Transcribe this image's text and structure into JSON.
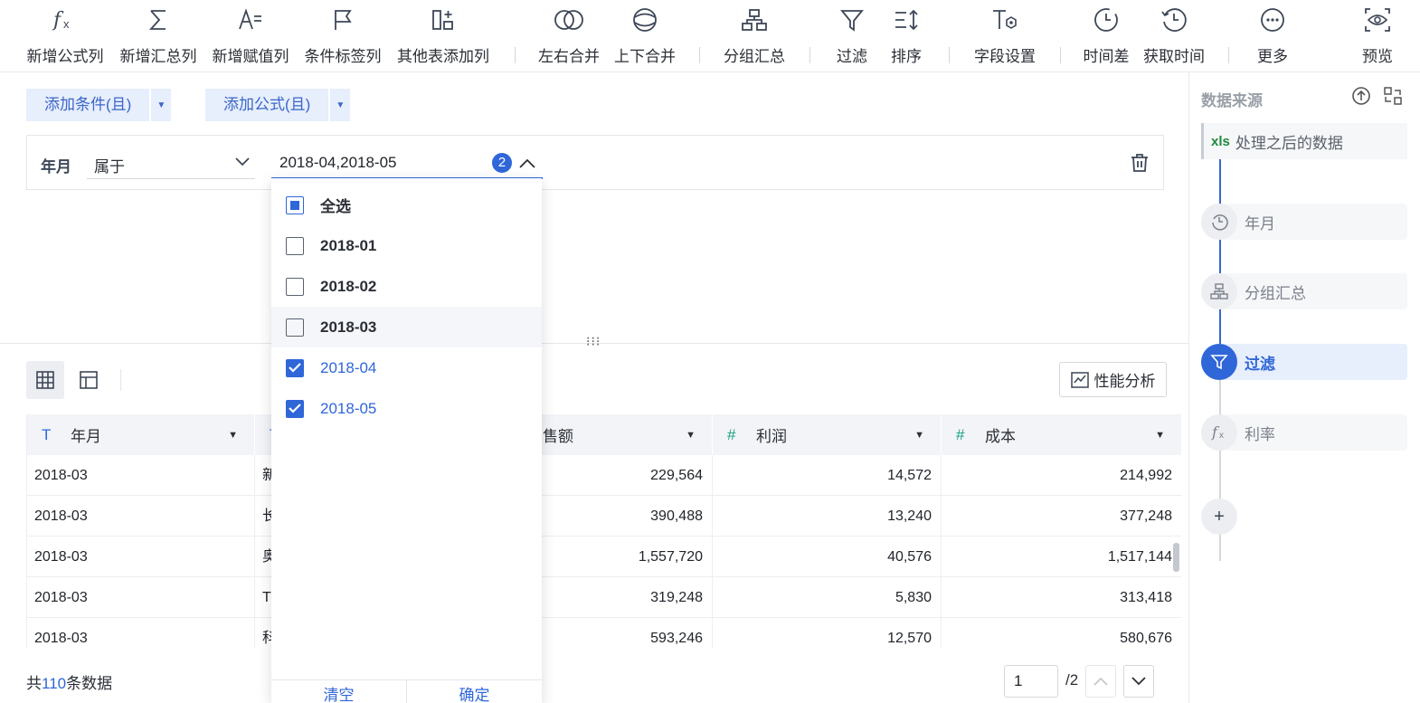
{
  "toolbar": {
    "items": [
      {
        "label": "新增公式列",
        "icon": "formula-icon"
      },
      {
        "label": "新增汇总列",
        "icon": "sum-icon"
      },
      {
        "label": "新增赋值列",
        "icon": "assign-icon"
      },
      {
        "label": "条件标签列",
        "icon": "flag-icon"
      },
      {
        "label": "其他表添加列",
        "icon": "add-column-icon"
      },
      {
        "label": "左右合并",
        "icon": "horizontal-merge-icon"
      },
      {
        "label": "上下合并",
        "icon": "vertical-merge-icon"
      },
      {
        "label": "分组汇总",
        "icon": "group-icon"
      },
      {
        "label": "过滤",
        "icon": "filter-icon"
      },
      {
        "label": "排序",
        "icon": "sort-icon"
      },
      {
        "label": "字段设置",
        "icon": "field-settings-icon"
      },
      {
        "label": "时间差",
        "icon": "time-diff-icon"
      },
      {
        "label": "获取时间",
        "icon": "get-time-icon"
      },
      {
        "label": "更多",
        "icon": "more-icon"
      },
      {
        "label": "预览",
        "icon": "preview-icon"
      }
    ]
  },
  "filter": {
    "add_condition": "添加条件(且)",
    "add_formula": "添加公式(且)",
    "field": "年月",
    "operator": "属于",
    "value": "2018-04,2018-05",
    "selected_count": "2"
  },
  "dropdown": {
    "options": [
      {
        "label": "全选",
        "state": "partial"
      },
      {
        "label": "2018-01",
        "state": "unchecked"
      },
      {
        "label": "2018-02",
        "state": "unchecked"
      },
      {
        "label": "2018-03",
        "state": "unchecked"
      },
      {
        "label": "2018-04",
        "state": "checked"
      },
      {
        "label": "2018-05",
        "state": "checked"
      }
    ],
    "clear": "清空",
    "confirm": "确定"
  },
  "preview": {
    "perf_label": "性能分析",
    "columns": [
      {
        "type_icon": "T",
        "name": "年月"
      },
      {
        "type_icon": "T",
        "name": ""
      },
      {
        "type_icon": "#",
        "name": "销售额"
      },
      {
        "type_icon": "#",
        "name": "利润"
      },
      {
        "type_icon": "#",
        "name": "成本"
      }
    ],
    "rows": [
      {
        "month": "2018-03",
        "name": "新",
        "sales": "229,564",
        "profit": "14,572",
        "cost": "214,992"
      },
      {
        "month": "2018-03",
        "name": "长",
        "sales": "390,488",
        "profit": "13,240",
        "cost": "377,248"
      },
      {
        "month": "2018-03",
        "name": "奥",
        "sales": "1,557,720",
        "profit": "40,576",
        "cost": "1,517,144"
      },
      {
        "month": "2018-03",
        "name": "T",
        "sales": "319,248",
        "profit": "5,830",
        "cost": "313,418"
      },
      {
        "month": "2018-03",
        "name": "科",
        "sales": "593,246",
        "profit": "12,570",
        "cost": "580,676"
      }
    ],
    "count_prefix": "共",
    "count": "110",
    "count_suffix": "条数据",
    "page": "1",
    "page_total": "/2"
  },
  "sidebar": {
    "title": "数据来源",
    "source_badge": "xls",
    "source": "处理之后的数据",
    "steps": [
      {
        "label": "年月",
        "icon": "time-icon",
        "active": false
      },
      {
        "label": "分组汇总",
        "icon": "group-icon",
        "active": false
      },
      {
        "label": "过滤",
        "icon": "filter-icon",
        "active": true
      },
      {
        "label": "利率",
        "icon": "formula-icon",
        "active": false
      }
    ],
    "add": "+"
  },
  "colors": {
    "accent": "#2f66d8",
    "header_bg": "#f2f4f7",
    "number_type": "#16a085"
  }
}
